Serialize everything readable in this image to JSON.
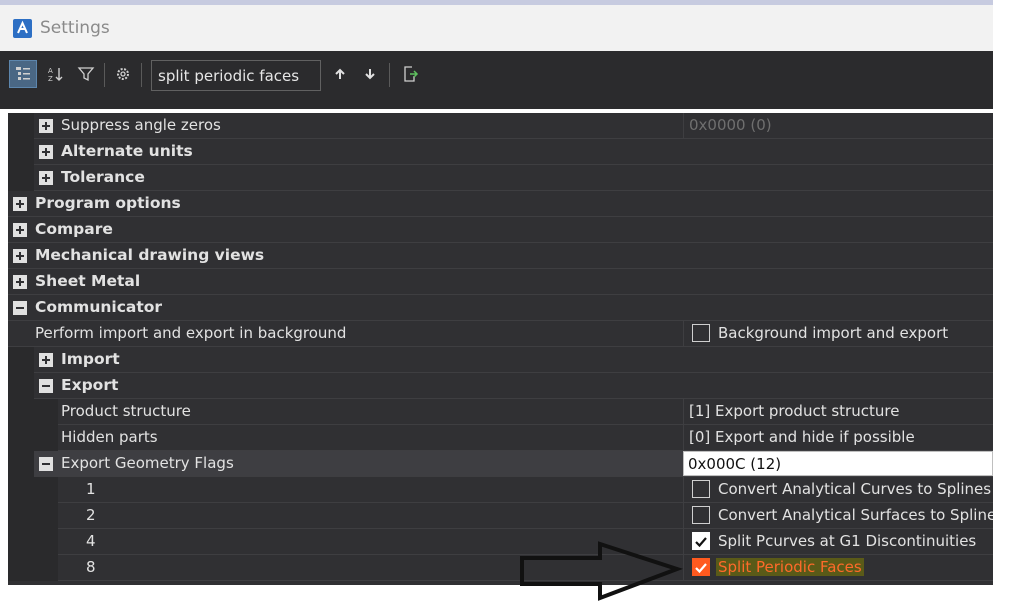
{
  "window": {
    "title": "Settings"
  },
  "toolbar": {
    "buttons": [
      {
        "name": "categorized-view-icon",
        "active": true
      },
      {
        "name": "sort-alpha-icon",
        "active": false
      },
      {
        "name": "filter-icon",
        "active": false
      },
      {
        "name": "gear-icon",
        "active": false
      },
      {
        "name": "arrow-up-icon",
        "active": false
      },
      {
        "name": "arrow-down-icon",
        "active": false
      },
      {
        "name": "export-icon",
        "active": false
      }
    ],
    "search_value": "split periodic faces"
  },
  "rows": {
    "r0": {
      "name": "Suppress angle zeros",
      "value": "0x0000 (0)"
    },
    "r1": {
      "name": "Alternate units"
    },
    "r2": {
      "name": "Tolerance"
    },
    "r3": {
      "name": "Program options"
    },
    "r4": {
      "name": "Compare"
    },
    "r5": {
      "name": "Mechanical drawing views"
    },
    "r6": {
      "name": "Sheet Metal"
    },
    "r7": {
      "name": "Communicator"
    },
    "r8": {
      "name": "Perform import and export in background",
      "value": "Background import and export",
      "checked": false
    },
    "r9": {
      "name": "Import"
    },
    "r10": {
      "name": "Export"
    },
    "r11": {
      "name": "Product structure",
      "value": "[1] Export product structure"
    },
    "r12": {
      "name": "Hidden parts",
      "value": "[0] Export and hide if possible"
    },
    "r13": {
      "name": "Export Geometry Flags",
      "value": "0x000C (12)"
    },
    "r14": {
      "name": "1",
      "value": "Convert Analytical Curves to Splines",
      "checked": false
    },
    "r15": {
      "name": "2",
      "value": "Convert Analytical Surfaces to Splines",
      "checked": false
    },
    "r16": {
      "name": "4",
      "value": "Split Pcurves at G1 Discontinuities",
      "checked": true
    },
    "r17": {
      "name": "8",
      "value": "Split Periodic Faces",
      "checked": true
    }
  },
  "colors": {
    "accent_orange": "#ff5a1f",
    "highlight": "#5a5a18",
    "grid_bg": "#303033",
    "toolbar_bg": "#2b2b2d"
  }
}
